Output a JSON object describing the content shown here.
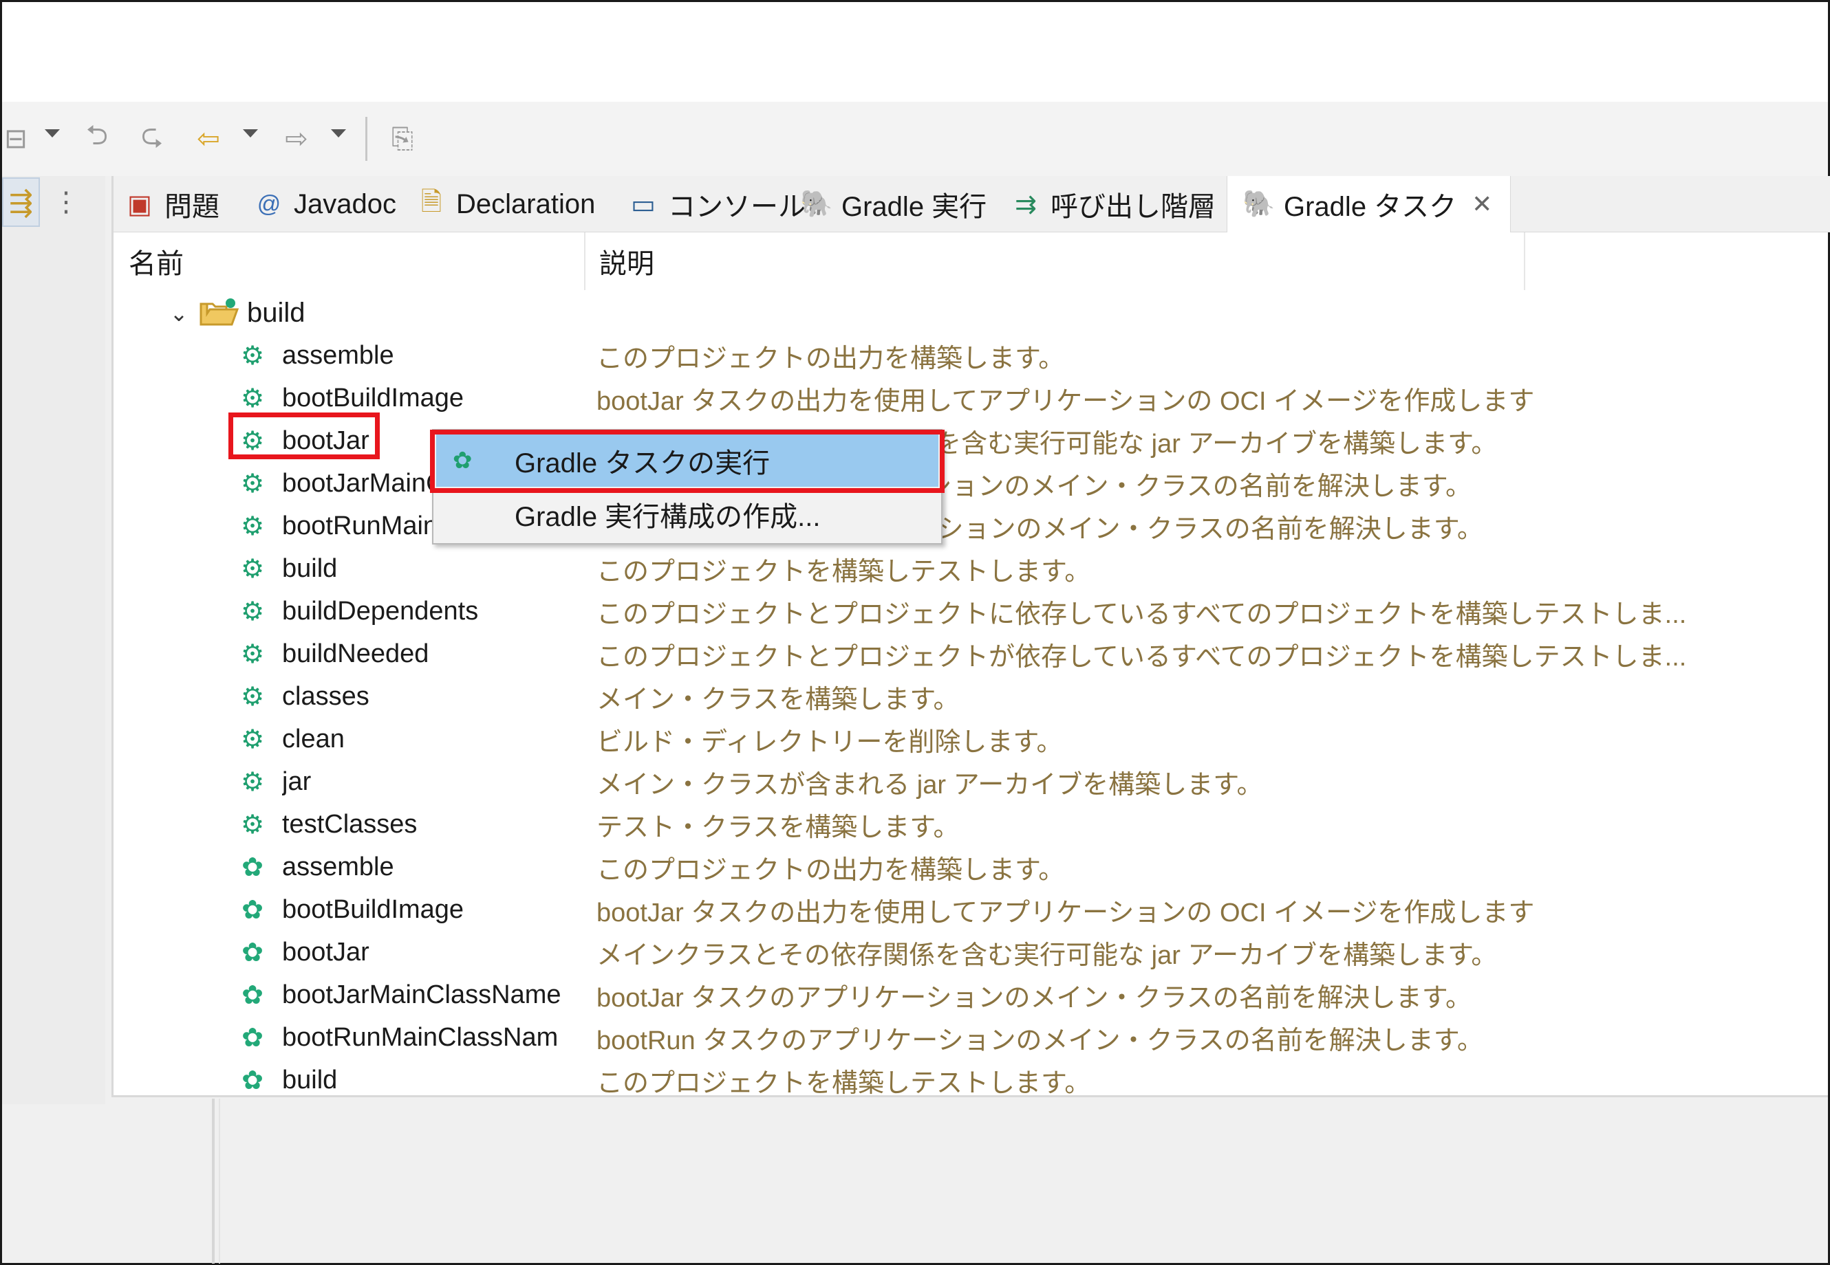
{
  "toolbar": {
    "icons": [
      "collapse-icon",
      "back-edit-icon",
      "forward-edit-icon",
      "back-arrow-icon",
      "forward-arrow-icon",
      "pin-editor-icon"
    ]
  },
  "tabs": [
    {
      "label": "問題",
      "icon": "problems-icon"
    },
    {
      "label": "Javadoc",
      "icon": "at-icon"
    },
    {
      "label": "Declaration",
      "icon": "declaration-icon"
    },
    {
      "label": "コンソール",
      "icon": "console-icon"
    },
    {
      "label": "Gradle 実行",
      "icon": "gradle-elephant-icon"
    },
    {
      "label": "呼び出し階層",
      "icon": "call-hierarchy-icon"
    },
    {
      "label": "Gradle タスク",
      "icon": "gradle-elephant-icon",
      "active": true
    }
  ],
  "columns": {
    "name": "名前",
    "description": "説明"
  },
  "tree": {
    "root_label": "build"
  },
  "rows": [
    {
      "name": "assemble",
      "desc": "このプロジェクトの出力を構築します。"
    },
    {
      "name": "bootBuildImage",
      "desc": "bootJar タスクの出力を使用してアプリケーションの OCI イメージを作成します"
    },
    {
      "name": "bootJar",
      "desc": "メインクラスとその依存関係を含む実行可能な jar アーカイブを構築します。"
    },
    {
      "name": "bootJarMainClassName",
      "desc": "bootJar タスクのアプリケーションのメイン・クラスの名前を解決します。"
    },
    {
      "name": "bootRunMainClassName",
      "desc": "bootRun タスクのアプリケーションのメイン・クラスの名前を解決します。"
    },
    {
      "name": "build",
      "desc": "このプロジェクトを構築しテストします。"
    },
    {
      "name": "buildDependents",
      "desc": "このプロジェクトとプロジェクトに依存しているすべてのプロジェクトを構築しテストしま..."
    },
    {
      "name": "buildNeeded",
      "desc": "このプロジェクトとプロジェクトが依存しているすべてのプロジェクトを構築しテストしま..."
    },
    {
      "name": "classes",
      "desc": "メイン・クラスを構築します。"
    },
    {
      "name": "clean",
      "desc": "ビルド・ディレクトリーを削除します。"
    },
    {
      "name": "jar",
      "desc": "メイン・クラスが含まれる jar アーカイブを構築します。"
    },
    {
      "name": "testClasses",
      "desc": "テスト・クラスを構築します。"
    },
    {
      "name": "assemble",
      "desc": "このプロジェクトの出力を構築します。"
    },
    {
      "name": "bootBuildImage",
      "desc": "bootJar タスクの出力を使用してアプリケーションの OCI イメージを作成します"
    },
    {
      "name": "bootJar",
      "desc": "メインクラスとその依存関係を含む実行可能な jar アーカイブを構築します。"
    },
    {
      "name": "bootJarMainClassName",
      "desc": "bootJar タスクのアプリケーションのメイン・クラスの名前を解決します。"
    },
    {
      "name": "bootRunMainClassNam",
      "desc": "bootRun タスクのアプリケーションのメイン・クラスの名前を解決します。"
    },
    {
      "name": "build",
      "desc": "このプロジェクトを構築しテストします。"
    }
  ],
  "context_menu": {
    "items": [
      {
        "label": "Gradle タスクの実行",
        "icon": "gear-icon",
        "selected": true
      },
      {
        "label": "Gradle 実行構成の作成..."
      }
    ]
  },
  "colors": {
    "highlight_border": "#e8161d",
    "menu_selection": "#99c9ef",
    "description_text": "#8a7340",
    "task_icon": "#1f9f6f"
  }
}
